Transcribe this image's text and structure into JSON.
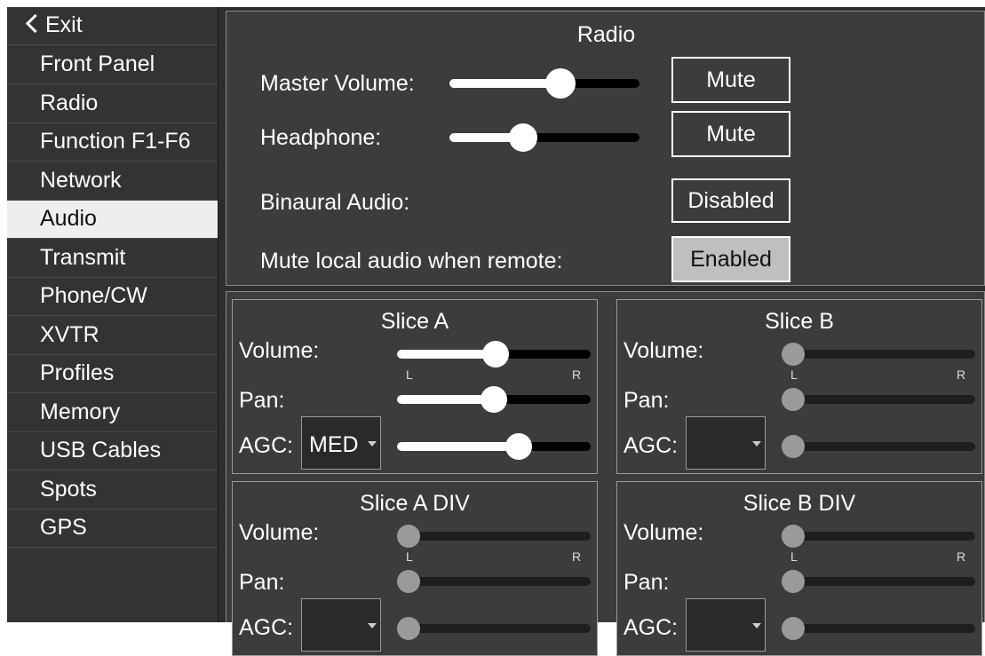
{
  "sidebar": {
    "exit_label": "Exit",
    "items": [
      {
        "label": "Front Panel",
        "active": false
      },
      {
        "label": "Radio",
        "active": false
      },
      {
        "label": "Function F1-F6",
        "active": false
      },
      {
        "label": "Network",
        "active": false
      },
      {
        "label": "Audio",
        "active": true
      },
      {
        "label": "Transmit",
        "active": false
      },
      {
        "label": "Phone/CW",
        "active": false
      },
      {
        "label": "XVTR",
        "active": false
      },
      {
        "label": "Profiles",
        "active": false
      },
      {
        "label": "Memory",
        "active": false
      },
      {
        "label": "USB Cables",
        "active": false
      },
      {
        "label": "Spots",
        "active": false
      },
      {
        "label": "GPS",
        "active": false
      }
    ]
  },
  "radio": {
    "title": "Radio",
    "master_volume": {
      "label": "Master Volume:",
      "value": 0.6,
      "mute_label": "Mute"
    },
    "headphone": {
      "label": "Headphone:",
      "value": 0.37,
      "mute_label": "Mute"
    },
    "binaural": {
      "label": "Binaural Audio:",
      "button": "Disabled",
      "on": false
    },
    "mute_local": {
      "label": "Mute local audio when remote:",
      "button": "Enabled",
      "on": true
    }
  },
  "slices": [
    {
      "title": "Slice A",
      "volume_label": "Volume:",
      "pan_label": "Pan:",
      "agc_label": "AGC:",
      "agc_value": "MED",
      "volume": 0.51,
      "pan": 0.5,
      "agc_level": 0.65,
      "left_label": "L",
      "right_label": "R",
      "active": true
    },
    {
      "title": "Slice B",
      "volume_label": "Volume:",
      "pan_label": "Pan:",
      "agc_label": "AGC:",
      "agc_value": "",
      "volume": 0,
      "pan": 0,
      "agc_level": 0,
      "left_label": "L",
      "right_label": "R",
      "active": false
    },
    {
      "title": "Slice A DIV",
      "volume_label": "Volume:",
      "pan_label": "Pan:",
      "agc_label": "AGC:",
      "agc_value": "",
      "volume": 0,
      "pan": 0,
      "agc_level": 0,
      "left_label": "L",
      "right_label": "R",
      "active": false
    },
    {
      "title": "Slice B DIV",
      "volume_label": "Volume:",
      "pan_label": "Pan:",
      "agc_label": "AGC:",
      "agc_value": "",
      "volume": 0,
      "pan": 0,
      "agc_level": 0,
      "left_label": "L",
      "right_label": "R",
      "active": false
    }
  ],
  "colors": {
    "panel": "#3c3c3c",
    "sidebar": "#333333",
    "active_item": "#eeeeee",
    "enabled_button": "#bfbfbf",
    "slider_fill": "#ffffff",
    "slider_track": "#000000"
  },
  "icons": {
    "exit": "chevron-left-icon",
    "dropdown": "caret-down-icon"
  }
}
